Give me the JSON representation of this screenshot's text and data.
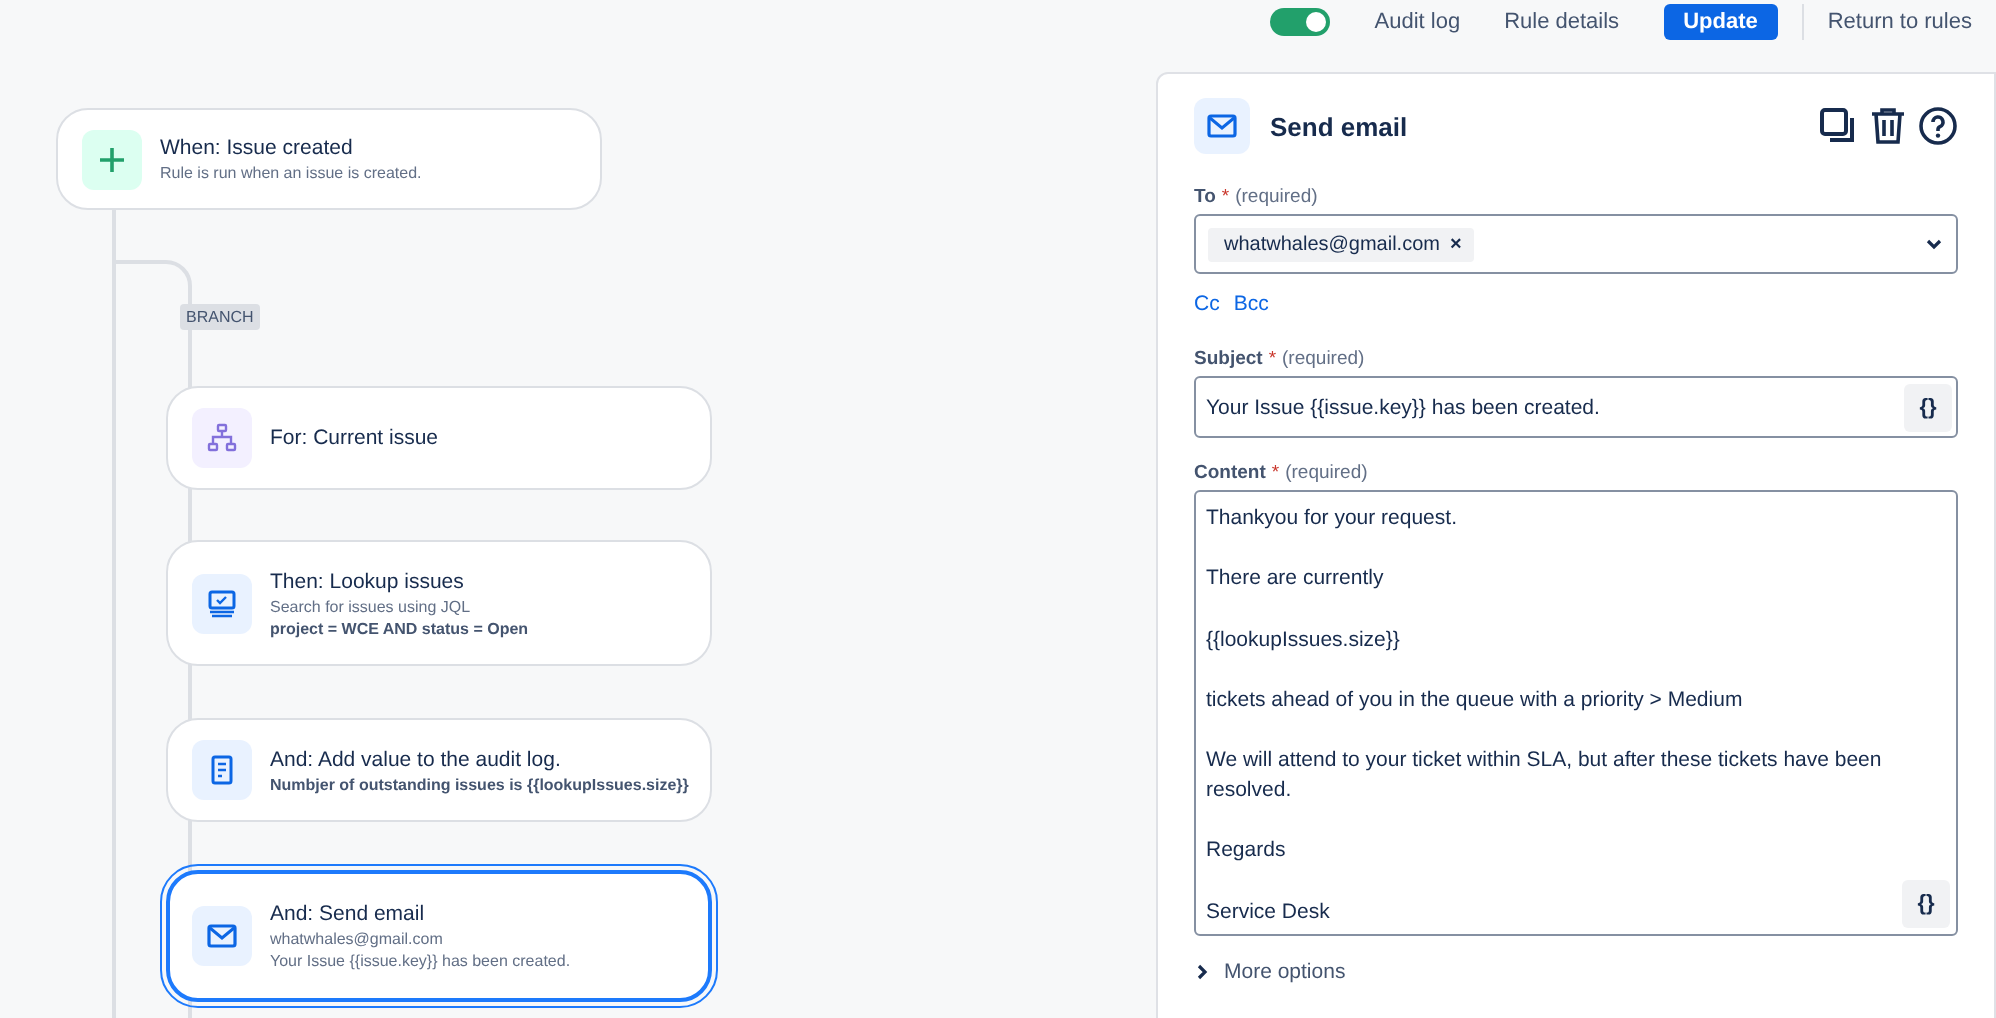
{
  "top_bar": {
    "toggle": {
      "on": true
    },
    "links": [
      "Audit log",
      "Rule details"
    ],
    "primary_button": "Update",
    "secondary_link": "Return to rules"
  },
  "flow": {
    "trigger": {
      "kind": "trigger",
      "title": "When: Issue created",
      "lines": [
        {
          "text": "Rule is run when an issue is created.",
          "bold": false
        }
      ]
    },
    "branch_label": "BRANCH",
    "steps": [
      {
        "kind": "branch",
        "title": "For: Current issue",
        "selected": false
      },
      {
        "kind": "lookup",
        "title": "Then: Lookup issues",
        "lines": [
          {
            "text": "Search for issues using JQL",
            "bold": false
          },
          {
            "text": "project = WCE AND status = Open",
            "bold": true
          }
        ],
        "selected": false
      },
      {
        "kind": "log",
        "title": "And: Add value to the audit log.",
        "lines": [
          {
            "text": "Numbjer of outstanding issues is {{lookupIssues.size}}",
            "bold": true
          }
        ],
        "selected": false
      },
      {
        "kind": "email",
        "title": "And: Send email",
        "lines": [
          {
            "text": "whatwhales@gmail.com",
            "bold": false
          },
          {
            "text": "Your Issue {{issue.key}} has been created.",
            "bold": false
          }
        ],
        "selected": true
      }
    ]
  },
  "panel": {
    "title": "Send email",
    "to": {
      "label": "To",
      "required_mark": "*",
      "hint": "(required)",
      "chips": [
        "whatwhales@gmail.com"
      ],
      "chip_remove": "×"
    },
    "cc_links": [
      "Cc",
      "Bcc"
    ],
    "subject": {
      "label": "Subject",
      "required_mark": "*",
      "hint": "(required)",
      "value": "Your Issue {{issue.key}} has been created.",
      "smart_button": "{}"
    },
    "content": {
      "label": "Content",
      "required_mark": "*",
      "hint": "(required)",
      "paragraphs": [
        "Thankyou for your request.",
        "There are currently",
        "{{lookupIssues.size}}",
        "tickets ahead of you in the queue with a priority > Medium",
        "We will attend to your ticket within SLA, but after these tickets have been resolved.",
        "Regards",
        "Service Desk"
      ],
      "smart_button": "{}"
    },
    "more_options": "More options"
  }
}
